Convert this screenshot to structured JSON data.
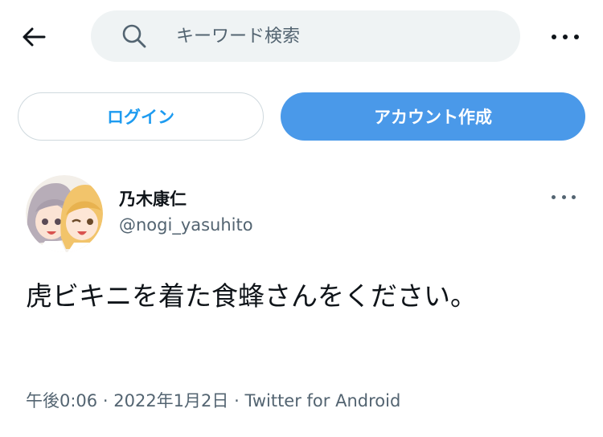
{
  "header": {
    "search_placeholder": "キーワード検索"
  },
  "buttons": {
    "login_label": "ログイン",
    "signup_label": "アカウント作成"
  },
  "tweet": {
    "display_name": "乃木康仁",
    "handle": "@nogi_yasuhito",
    "text": "虎ビキニを着た食蜂さんをください。",
    "time": "午後0:06",
    "separator": "·",
    "date": "2022年1月2日",
    "source": "Twitter for Android"
  },
  "icons": {
    "back": "arrow-left-icon",
    "search": "search-icon",
    "more": "more-horizontal-icon"
  },
  "colors": {
    "accent": "#1d9bf0",
    "signup_bg": "#4a99e9",
    "search_bg": "#eff3f4",
    "muted_text": "#536471",
    "primary_text": "#0f1419"
  }
}
